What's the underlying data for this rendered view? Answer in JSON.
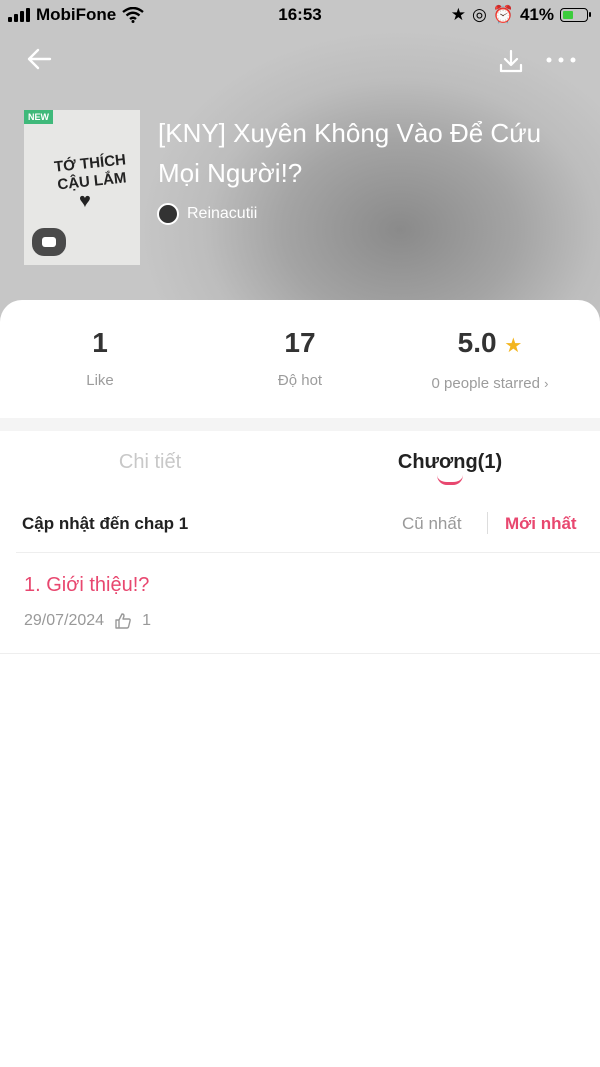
{
  "status_bar": {
    "carrier": "MobiFone",
    "time": "16:53",
    "battery": "41%"
  },
  "book": {
    "badge": "NEW",
    "cover_text": "TỚ THÍCH CẬU LẮM",
    "title": "[KNY] Xuyên Không Vào Để Cứu Mọi Người!?",
    "author": "Reinacutii"
  },
  "stats": {
    "likes": "1",
    "likes_label": "Like",
    "hot": "17",
    "hot_label": "Độ hot",
    "rating": "5.0",
    "rating_label": "0 people starred"
  },
  "tabs": {
    "details": "Chi tiết",
    "chapters": "Chương(1)"
  },
  "sort": {
    "label": "Cập nhật đến chap 1",
    "oldest": "Cũ nhất",
    "newest": "Mới nhất"
  },
  "chapters": [
    {
      "title": "1. Giới thiệu!?",
      "date": "29/07/2024",
      "likes": "1"
    }
  ],
  "colors": {
    "accent": "#e8476f",
    "star": "#f3b51e"
  }
}
